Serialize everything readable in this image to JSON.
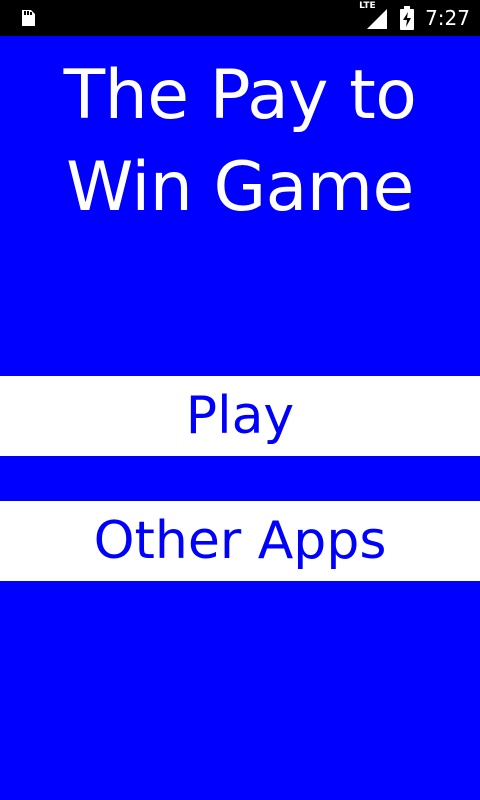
{
  "status_bar": {
    "network": "LTE",
    "time": "7:27",
    "icons": [
      "sd-card-icon",
      "lte-signal-icon",
      "battery-charging-icon"
    ]
  },
  "title": "The Pay to Win Game",
  "buttons": {
    "play": "Play",
    "other_apps": "Other Apps"
  },
  "colors": {
    "background": "#0000FF",
    "button_background": "#FFFFFF",
    "button_text": "#0000FF",
    "title_text": "#FFFFFF",
    "status_bar": "#000000"
  }
}
